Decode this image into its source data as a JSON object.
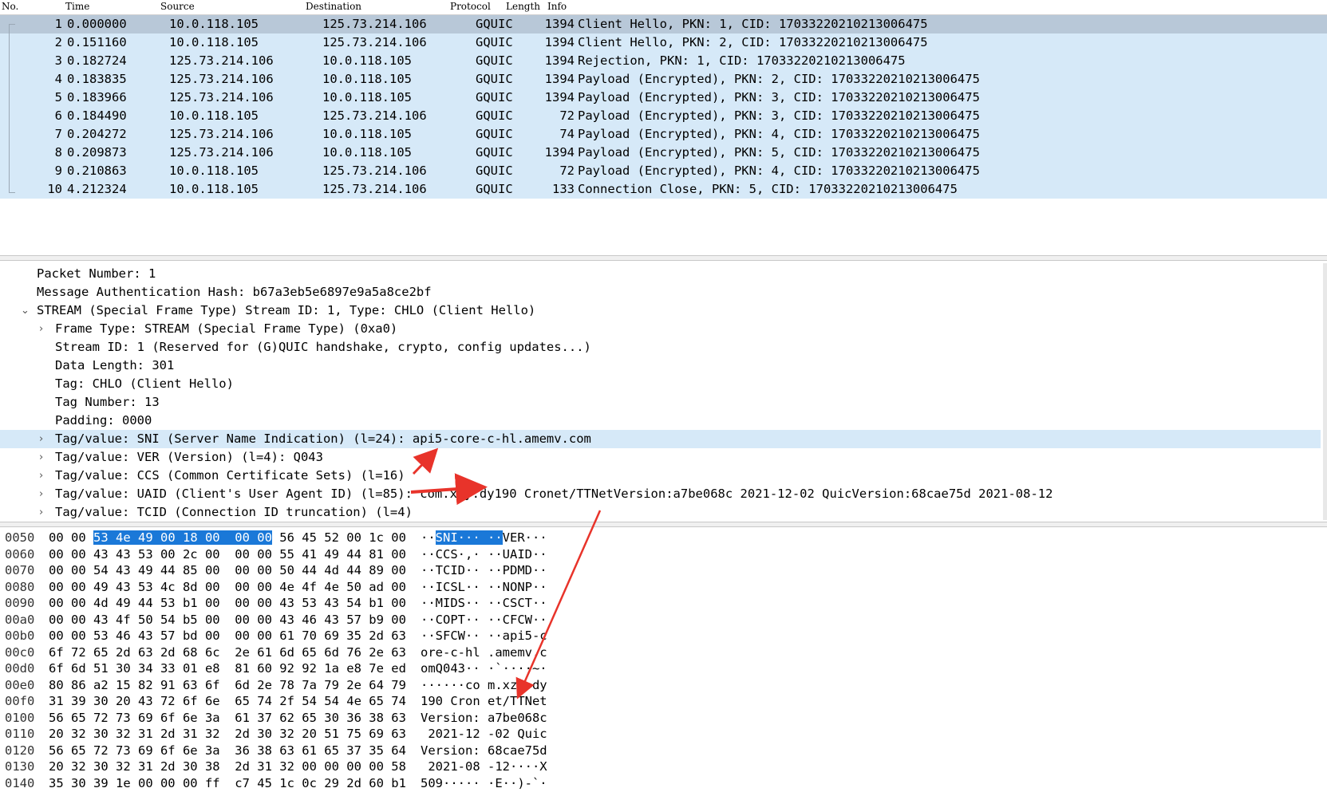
{
  "packet_list": {
    "columns": [
      "No.",
      "Time",
      "Source",
      "Destination",
      "Protocol",
      "Length",
      "Info"
    ],
    "rows": [
      {
        "no": "1",
        "time": "0.000000",
        "src": "10.0.118.105",
        "dst": "125.73.214.106",
        "proto": "GQUIC",
        "len": "1394",
        "info": "Client Hello, PKN: 1, CID: 17033220210213006475"
      },
      {
        "no": "2",
        "time": "0.151160",
        "src": "10.0.118.105",
        "dst": "125.73.214.106",
        "proto": "GQUIC",
        "len": "1394",
        "info": "Client Hello, PKN: 2, CID: 17033220210213006475"
      },
      {
        "no": "3",
        "time": "0.182724",
        "src": "125.73.214.106",
        "dst": "10.0.118.105",
        "proto": "GQUIC",
        "len": "1394",
        "info": "Rejection, PKN: 1, CID: 17033220210213006475"
      },
      {
        "no": "4",
        "time": "0.183835",
        "src": "125.73.214.106",
        "dst": "10.0.118.105",
        "proto": "GQUIC",
        "len": "1394",
        "info": "Payload (Encrypted), PKN: 2, CID: 17033220210213006475"
      },
      {
        "no": "5",
        "time": "0.183966",
        "src": "125.73.214.106",
        "dst": "10.0.118.105",
        "proto": "GQUIC",
        "len": "1394",
        "info": "Payload (Encrypted), PKN: 3, CID: 17033220210213006475"
      },
      {
        "no": "6",
        "time": "0.184490",
        "src": "10.0.118.105",
        "dst": "125.73.214.106",
        "proto": "GQUIC",
        "len": "72",
        "info": "Payload (Encrypted), PKN: 3, CID: 17033220210213006475"
      },
      {
        "no": "7",
        "time": "0.204272",
        "src": "125.73.214.106",
        "dst": "10.0.118.105",
        "proto": "GQUIC",
        "len": "74",
        "info": "Payload (Encrypted), PKN: 4, CID: 17033220210213006475"
      },
      {
        "no": "8",
        "time": "0.209873",
        "src": "125.73.214.106",
        "dst": "10.0.118.105",
        "proto": "GQUIC",
        "len": "1394",
        "info": "Payload (Encrypted), PKN: 5, CID: 17033220210213006475"
      },
      {
        "no": "9",
        "time": "0.210863",
        "src": "10.0.118.105",
        "dst": "125.73.214.106",
        "proto": "GQUIC",
        "len": "72",
        "info": "Payload (Encrypted), PKN: 4, CID: 17033220210213006475"
      },
      {
        "no": "10",
        "time": "4.212324",
        "src": "10.0.118.105",
        "dst": "125.73.214.106",
        "proto": "GQUIC",
        "len": "133",
        "info": "Connection Close, PKN: 5, CID: 17033220210213006475"
      }
    ]
  },
  "details": {
    "rows": [
      {
        "text": "Packet Number: 1",
        "chev": ""
      },
      {
        "text": "Message Authentication Hash: b67a3eb5e6897e9a5a8ce2bf",
        "chev": ""
      },
      {
        "text": "STREAM (Special Frame Type) Stream ID: 1, Type: CHLO (Client Hello)",
        "chev": "open"
      },
      {
        "text": "Frame Type: STREAM (Special Frame Type) (0xa0)",
        "chev": "closed"
      },
      {
        "text": "Stream ID: 1 (Reserved for (G)QUIC handshake, crypto, config updates...)",
        "chev": ""
      },
      {
        "text": "Data Length: 301",
        "chev": ""
      },
      {
        "text": "Tag: CHLO (Client Hello)",
        "chev": ""
      },
      {
        "text": "Tag Number: 13",
        "chev": ""
      },
      {
        "text": "Padding: 0000",
        "chev": ""
      },
      {
        "text": "Tag/value: SNI (Server Name Indication) (l=24): api5-core-c-hl.amemv.com",
        "chev": "closed"
      },
      {
        "text": "Tag/value: VER (Version) (l=4): Q043",
        "chev": "closed"
      },
      {
        "text": "Tag/value: CCS (Common Certificate Sets) (l=16)",
        "chev": "closed"
      },
      {
        "text": "Tag/value: UAID (Client's User Agent ID) (l=85): com.xzy.dy190 Cronet/TTNetVersion:a7be068c 2021-12-02 QuicVersion:68cae75d 2021-08-12",
        "chev": "closed"
      },
      {
        "text": "Tag/value: TCID (Connection ID truncation) (l=4)",
        "chev": "closed"
      }
    ],
    "glyphs": {
      "open": "⌄",
      "closed": "›"
    }
  },
  "bytes": {
    "rows": [
      {
        "off": "0050",
        "h1": "00 00 ",
        "hh": "53 4e 49 00 18 00  00 00",
        "h2": " 56 45 52 00 1c 00",
        "a1": "··",
        "ah": "SNI··· ··",
        "a2": "VER···"
      },
      {
        "off": "0060",
        "h1": "00 00 43 43 53 00 2c 00  00 00 55 41 49 44 81 00",
        "hh": "",
        "h2": "",
        "a1": "··CCS·,· ··UAID··",
        "ah": "",
        "a2": ""
      },
      {
        "off": "0070",
        "h1": "00 00 54 43 49 44 85 00  00 00 50 44 4d 44 89 00",
        "hh": "",
        "h2": "",
        "a1": "··TCID·· ··PDMD··",
        "ah": "",
        "a2": ""
      },
      {
        "off": "0080",
        "h1": "00 00 49 43 53 4c 8d 00  00 00 4e 4f 4e 50 ad 00",
        "hh": "",
        "h2": "",
        "a1": "··ICSL·· ··NONP··",
        "ah": "",
        "a2": ""
      },
      {
        "off": "0090",
        "h1": "00 00 4d 49 44 53 b1 00  00 00 43 53 43 54 b1 00",
        "hh": "",
        "h2": "",
        "a1": "··MIDS·· ··CSCT··",
        "ah": "",
        "a2": ""
      },
      {
        "off": "00a0",
        "h1": "00 00 43 4f 50 54 b5 00  00 00 43 46 43 57 b9 00",
        "hh": "",
        "h2": "",
        "a1": "··COPT·· ··CFCW··",
        "ah": "",
        "a2": ""
      },
      {
        "off": "00b0",
        "h1": "00 00 53 46 43 57 bd 00  00 00 61 70 69 35 2d 63",
        "hh": "",
        "h2": "",
        "a1": "··SFCW·· ··api5-c",
        "ah": "",
        "a2": ""
      },
      {
        "off": "00c0",
        "h1": "6f 72 65 2d 63 2d 68 6c  2e 61 6d 65 6d 76 2e 63",
        "hh": "",
        "h2": "",
        "a1": "ore-c-hl .amemv.c",
        "ah": "",
        "a2": ""
      },
      {
        "off": "00d0",
        "h1": "6f 6d 51 30 34 33 01 e8  81 60 92 92 1a e8 7e ed",
        "hh": "",
        "h2": "",
        "a1": "omQ043·· ·`····~·",
        "ah": "",
        "a2": ""
      },
      {
        "off": "00e0",
        "h1": "80 86 a2 15 82 91 63 6f  6d 2e 78 7a 79 2e 64 79",
        "hh": "",
        "h2": "",
        "a1": "······co m.xzy.dy",
        "ah": "",
        "a2": ""
      },
      {
        "off": "00f0",
        "h1": "31 39 30 20 43 72 6f 6e  65 74 2f 54 54 4e 65 74",
        "hh": "",
        "h2": "",
        "a1": "190 Cron et/TTNet",
        "ah": "",
        "a2": ""
      },
      {
        "off": "0100",
        "h1": "56 65 72 73 69 6f 6e 3a  61 37 62 65 30 36 38 63",
        "hh": "",
        "h2": "",
        "a1": "Version: a7be068c",
        "ah": "",
        "a2": ""
      },
      {
        "off": "0110",
        "h1": "20 32 30 32 31 2d 31 32  2d 30 32 20 51 75 69 63",
        "hh": "",
        "h2": "",
        "a1": " 2021-12 -02 Quic",
        "ah": "",
        "a2": ""
      },
      {
        "off": "0120",
        "h1": "56 65 72 73 69 6f 6e 3a  36 38 63 61 65 37 35 64",
        "hh": "",
        "h2": "",
        "a1": "Version: 68cae75d",
        "ah": "",
        "a2": ""
      },
      {
        "off": "0130",
        "h1": "20 32 30 32 31 2d 30 38  2d 31 32 00 00 00 00 58",
        "hh": "",
        "h2": "",
        "a1": " 2021-08 -12····X",
        "ah": "",
        "a2": ""
      },
      {
        "off": "0140",
        "h1": "35 30 39 1e 00 00 00 ff  c7 45 1c 0c 29 2d 60 b1",
        "hh": "",
        "h2": "",
        "a1": "509····· ·E··)-`·",
        "ah": "",
        "a2": ""
      }
    ]
  },
  "colors": {
    "row_bg": "#d6e9f8",
    "selected_row": "#b8c8d8",
    "byte_highlight": "#1a78d8",
    "arrow": "#e8332a"
  }
}
